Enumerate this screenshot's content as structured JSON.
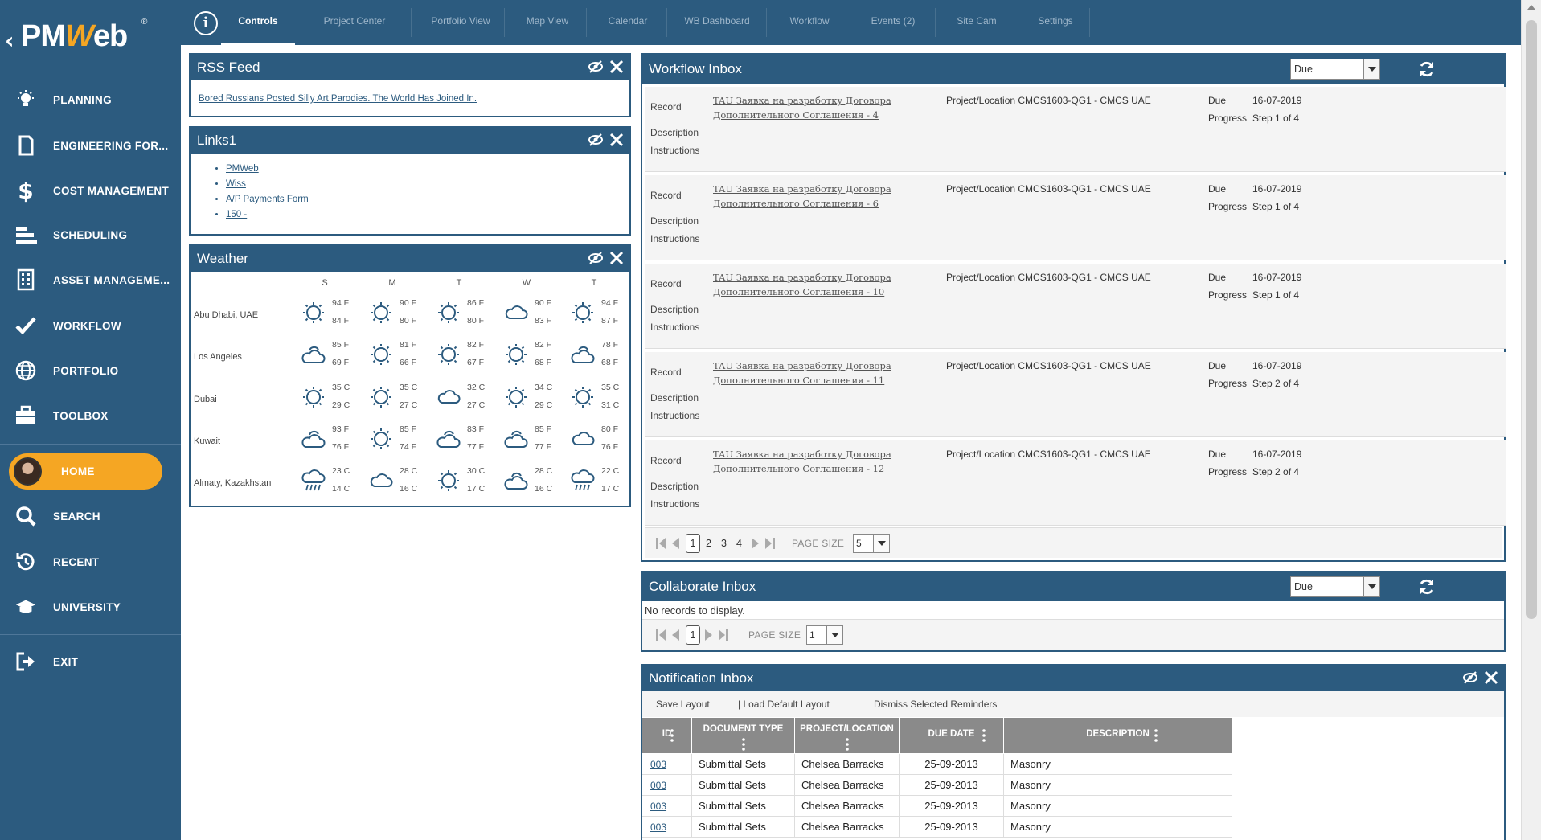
{
  "brand": {
    "logo_text_pm": "PM",
    "logo_text_w": "W",
    "logo_text_eb": "eb",
    "reg": "®"
  },
  "sidebar": {
    "items": [
      {
        "label": "PLANNING",
        "icon": "lightbulb-icon"
      },
      {
        "label": "ENGINEERING FOR...",
        "icon": "document-icon"
      },
      {
        "label": "COST MANAGEMENT",
        "icon": "dollar-icon"
      },
      {
        "label": "SCHEDULING",
        "icon": "gantt-icon"
      },
      {
        "label": "ASSET MANAGEME...",
        "icon": "building-icon"
      },
      {
        "label": "WORKFLOW",
        "icon": "checkmark-icon"
      },
      {
        "label": "PORTFOLIO",
        "icon": "globe-icon"
      },
      {
        "label": "TOOLBOX",
        "icon": "toolbox-icon"
      }
    ],
    "home": {
      "label": "HOME"
    },
    "lower_items": [
      {
        "label": "SEARCH",
        "icon": "search-icon"
      },
      {
        "label": "RECENT",
        "icon": "recent-icon"
      },
      {
        "label": "UNIVERSITY",
        "icon": "graduation-cap-icon"
      }
    ],
    "exit": {
      "label": "EXIT",
      "icon": "exit-icon"
    }
  },
  "topbar": {
    "tabs": [
      {
        "label": "Controls",
        "active": true
      },
      {
        "label": "Project Center"
      },
      {
        "label": "Portfolio View"
      },
      {
        "label": "Map View"
      },
      {
        "label": "Calendar"
      },
      {
        "label": "WB Dashboard"
      },
      {
        "label": "Workflow"
      },
      {
        "label": "Events (2)"
      },
      {
        "label": "Site Cam"
      },
      {
        "label": "Settings"
      }
    ]
  },
  "rss": {
    "title": "RSS Feed",
    "item": "Bored Russians Posted Silly Art Parodies. The World Has Joined In."
  },
  "links": {
    "title": "Links1",
    "items": [
      "PMWeb",
      "Wiss",
      "A/P Payments Form",
      "150 -"
    ]
  },
  "weather": {
    "title": "Weather",
    "days": [
      "S",
      "M",
      "T",
      "W",
      "T"
    ],
    "cities": [
      {
        "name": "Abu Dhabi, UAE",
        "icons": [
          "sun",
          "sun",
          "sun",
          "cloud",
          "sun"
        ],
        "high": [
          "94 F",
          "90 F",
          "86 F",
          "90 F",
          "94 F"
        ],
        "low": [
          "84 F",
          "80 F",
          "80 F",
          "83 F",
          "87 F"
        ]
      },
      {
        "name": "Los Angeles",
        "icons": [
          "partly-cloudy",
          "sun",
          "sun",
          "sun",
          "partly-cloudy"
        ],
        "high": [
          "85 F",
          "81 F",
          "82 F",
          "82 F",
          "78 F"
        ],
        "low": [
          "69 F",
          "66 F",
          "67 F",
          "68 F",
          "68 F"
        ]
      },
      {
        "name": "Dubai",
        "icons": [
          "sun",
          "sun",
          "cloud",
          "sun",
          "sun"
        ],
        "high": [
          "35 C",
          "35 C",
          "32 C",
          "34 C",
          "35 C"
        ],
        "low": [
          "29 C",
          "27 C",
          "27 C",
          "29 C",
          "31 C"
        ]
      },
      {
        "name": "Kuwait",
        "icons": [
          "partly-cloudy",
          "sun",
          "partly-cloudy",
          "partly-cloudy",
          "cloud"
        ],
        "high": [
          "93 F",
          "85 F",
          "83 F",
          "85 F",
          "80 F"
        ],
        "low": [
          "76 F",
          "74 F",
          "77 F",
          "77 F",
          "76 F"
        ]
      },
      {
        "name": "Almaty, Kazakhstan",
        "icons": [
          "rain",
          "cloud",
          "sun",
          "partly-cloudy",
          "rain"
        ],
        "high": [
          "23 C",
          "28 C",
          "30 C",
          "28 C",
          "22 C"
        ],
        "low": [
          "14 C",
          "16 C",
          "17 C",
          "16 C",
          "17 C"
        ]
      }
    ]
  },
  "workflow_inbox": {
    "title": "Workflow Inbox",
    "filter": "Due",
    "labels": {
      "record": "Record",
      "description": "Description",
      "instructions": "Instructions",
      "due": "Due",
      "progress": "Progress"
    },
    "records": [
      {
        "line1": "TAU Заявка на разработку Договора",
        "line2": "Дополнительного Соглашения - 4",
        "project": "Project/Location CMCS1603-QG1 - CMCS UAE",
        "due": "16-07-2019",
        "progress": "Step 1 of 4"
      },
      {
        "line1": "TAU Заявка на разработку Договора",
        "line2": "Дополнительного Соглашения - 6",
        "project": "Project/Location CMCS1603-QG1 - CMCS UAE",
        "due": "16-07-2019",
        "progress": "Step 1 of 4"
      },
      {
        "line1": "TAU Заявка на разработку Договора",
        "line2": "Дополнительного Соглашения - 10",
        "project": "Project/Location CMCS1603-QG1 - CMCS UAE",
        "due": "16-07-2019",
        "progress": "Step 1 of 4"
      },
      {
        "line1": "TAU Заявка на разработку Договора",
        "line2": "Дополнительного Соглашения - 11",
        "project": "Project/Location CMCS1603-QG1 - CMCS UAE",
        "due": "16-07-2019",
        "progress": "Step 2 of 4"
      },
      {
        "line1": "TAU Заявка на разработку Договора",
        "line2": "Дополнительного Соглашения - 12",
        "project": "Project/Location CMCS1603-QG1 - CMCS UAE",
        "due": "16-07-2019",
        "progress": "Step 2 of 4"
      }
    ],
    "pager": {
      "current": "1",
      "pages": [
        "2",
        "3",
        "4"
      ],
      "page_size_label": "PAGE SIZE",
      "page_size": "5"
    }
  },
  "collaborate_inbox": {
    "title": "Collaborate Inbox",
    "filter": "Due",
    "empty": "No records to display.",
    "pager": {
      "current": "1",
      "page_size_label": "PAGE SIZE",
      "page_size": "1"
    }
  },
  "notification_inbox": {
    "title": "Notification Inbox",
    "toolbar": [
      "Save Layout",
      "|  Load Default Layout",
      "Dismiss Selected Reminders"
    ],
    "columns": [
      "ID",
      "DOCUMENT TYPE",
      "PROJECT/LOCATION",
      "DUE DATE",
      "DESCRIPTION"
    ],
    "rows": [
      [
        "003",
        "Submittal Sets",
        "Chelsea Barracks",
        "25-09-2013",
        "Masonry"
      ],
      [
        "003",
        "Submittal Sets",
        "Chelsea Barracks",
        "25-09-2013",
        "Masonry"
      ],
      [
        "003",
        "Submittal Sets",
        "Chelsea Barracks",
        "25-09-2013",
        "Masonry"
      ],
      [
        "003",
        "Submittal Sets",
        "Chelsea Barracks",
        "25-09-2013",
        "Masonry"
      ]
    ]
  },
  "colors": {
    "primary": "#2c5b7f",
    "accent": "#f5a623",
    "header_gray": "#8a8a8a"
  }
}
